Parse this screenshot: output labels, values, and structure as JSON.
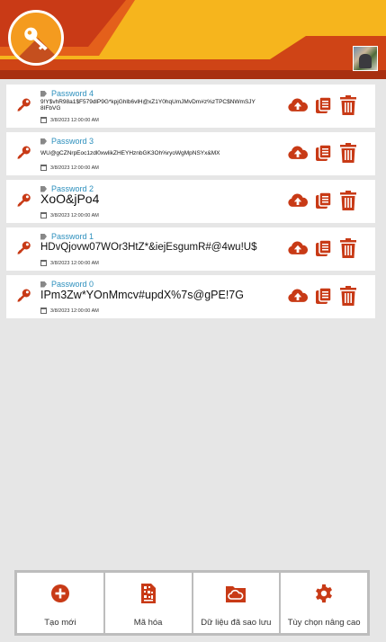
{
  "colors": {
    "accent_red": "#c83a16",
    "accent_orange": "#f6a91a",
    "label_blue": "#2c8fbd"
  },
  "header": {
    "logo_icon": "key-icon",
    "avatar": "user-avatar"
  },
  "passwords": [
    {
      "label": "Password 4",
      "value": "9!Y$vhR98a1$F579dlP9G*kpjGhlb6vlH@xZ1Y0hqUmJMvDm#z%zTPC$NWmSJY8IFbVG",
      "date": "3/8/2023 12:00:00 AM"
    },
    {
      "label": "Password 3",
      "value": "WU@gCZNrpEoc1zdl0xwlikZHEYHznbGK3Oh%ryoWgMpNSYx&MX",
      "date": "3/8/2023 12:00:00 AM"
    },
    {
      "label": "Password 2",
      "value": "XoO&jPo4",
      "date": "3/8/2023 12:00:00 AM"
    },
    {
      "label": "Password 1",
      "value": "HDvQjovw07WOr3HtZ*&iejEsgumR#@4wu!U$",
      "date": "3/8/2023 12:00:00 AM"
    },
    {
      "label": "Password 0",
      "value": "IPm3Zw*YOnMmcv#updX%7s@gPE!7G",
      "date": "3/8/2023 12:00:00 AM"
    }
  ],
  "nav": [
    {
      "label": "Tạo mới",
      "icon": "plus-circle-icon"
    },
    {
      "label": "Mã hóa",
      "icon": "qr-document-icon"
    },
    {
      "label": "Dữ liệu đã sao lưu",
      "icon": "cloud-folder-icon"
    },
    {
      "label": "Tùy chọn nâng cao",
      "icon": "gear-icon"
    }
  ]
}
